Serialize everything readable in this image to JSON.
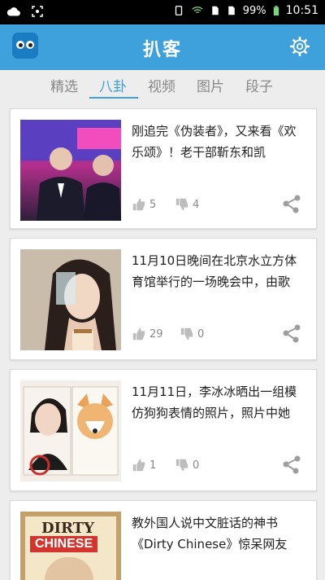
{
  "statusbar": {
    "battery": "99%",
    "time": "10:51"
  },
  "appbar": {
    "title": "扒客"
  },
  "tabs": [
    {
      "label": "精选",
      "active": false
    },
    {
      "label": "八卦",
      "active": true
    },
    {
      "label": "视频",
      "active": false
    },
    {
      "label": "图片",
      "active": false
    },
    {
      "label": "段子",
      "active": false
    }
  ],
  "cards": [
    {
      "text": "刚追完《伪装者》，又来看《欢乐颂》！老干部靳东和凯",
      "likes": "5",
      "dislikes": "4"
    },
    {
      "text": "11月10日晚间在北京水立方体育馆举行的一场晚会中，由歌",
      "likes": "29",
      "dislikes": "0"
    },
    {
      "text": "11月11日，李冰冰晒出一组模仿狗狗表情的照片，照片中她",
      "likes": "1",
      "dislikes": "0"
    },
    {
      "text": "教外国人说中文脏话的神书《Dirty Chinese》惊呆网友",
      "likes": "",
      "dislikes": ""
    }
  ],
  "book_cover": {
    "line1": "DIRTY",
    "line2": "CHINESE"
  },
  "colors": {
    "accent": "#3fa1dc",
    "statusbar": "#000000",
    "background": "#ededed"
  }
}
